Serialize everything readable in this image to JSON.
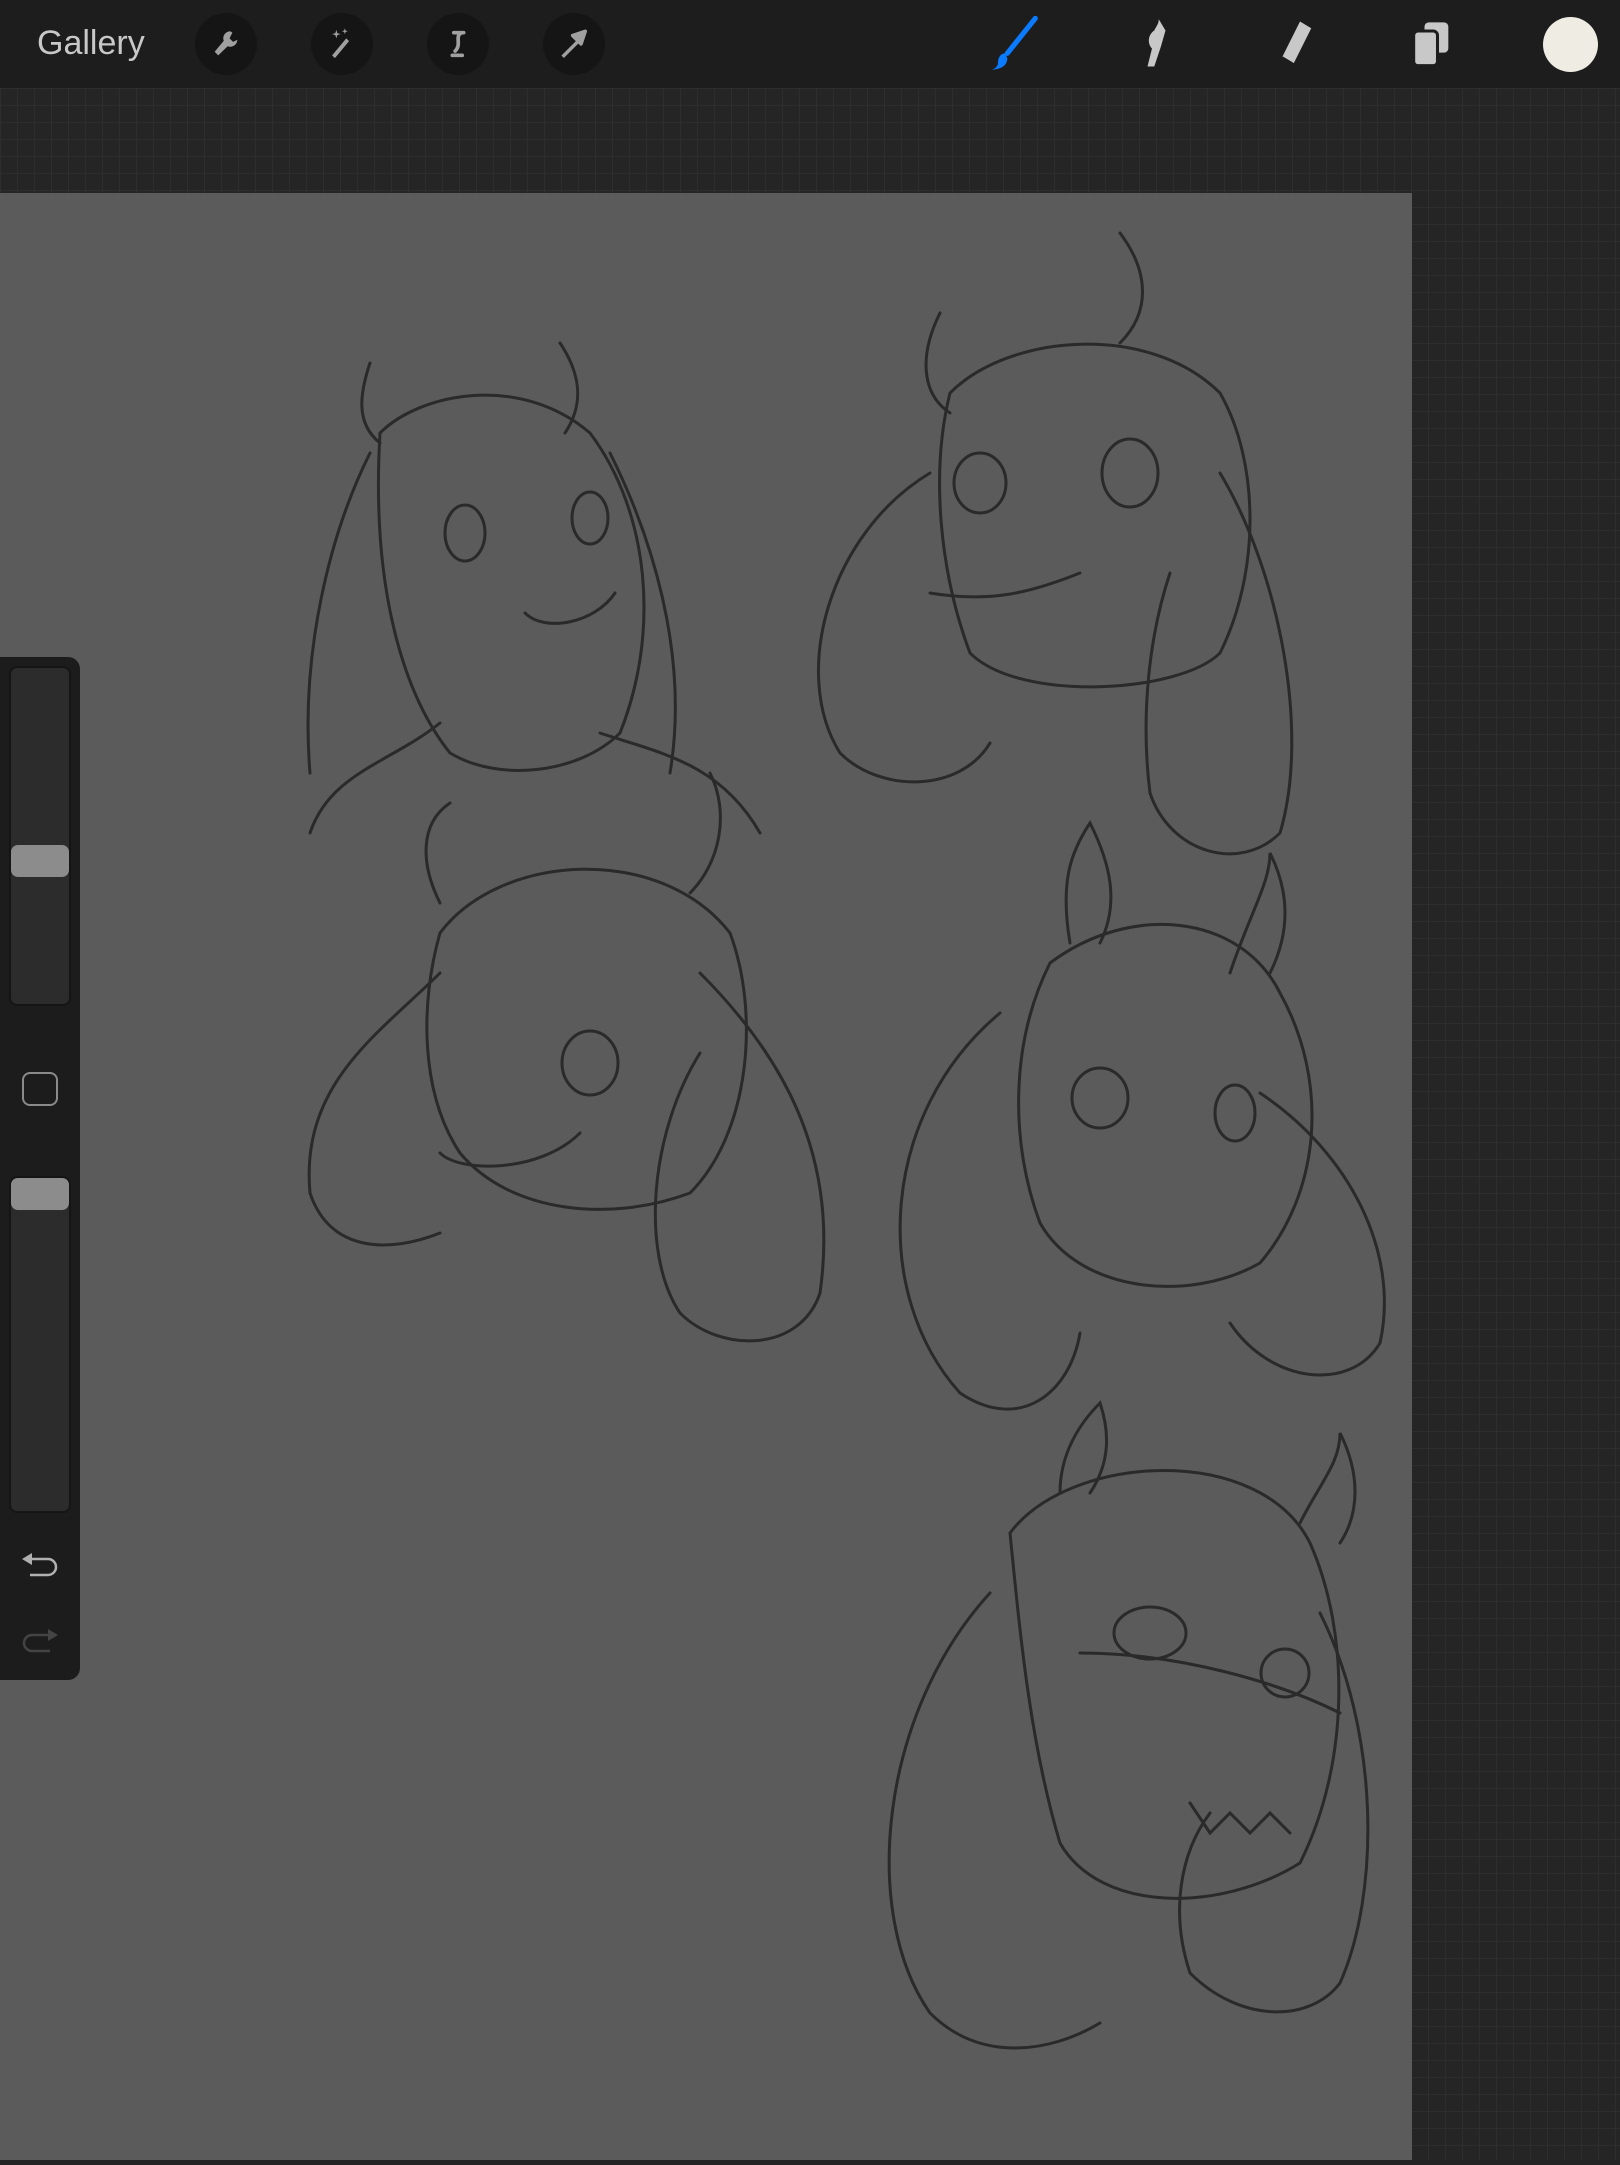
{
  "topbar": {
    "gallery_label": "Gallery",
    "left_tools": [
      "wrench-icon",
      "magic-wand-icon",
      "selection-icon",
      "transform-arrow-icon"
    ],
    "right_tools": [
      "brush-icon",
      "smudge-icon",
      "eraser-icon",
      "layers-icon"
    ],
    "active_tool": "brush",
    "accent_color": "#0a7aff",
    "current_color": "#efece4"
  },
  "sidebar": {
    "brush_size_level": 0.6,
    "opacity_level": 1.0
  }
}
